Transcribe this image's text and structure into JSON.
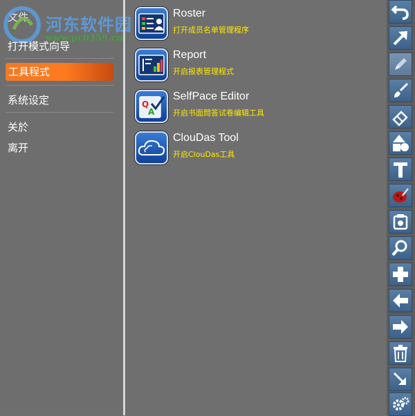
{
  "menu": {
    "title": "文件",
    "items": [
      {
        "label": "打开模式向导"
      },
      {
        "label": "工具程式"
      },
      {
        "label": "系统设定"
      },
      {
        "label": "关於"
      },
      {
        "label": "离开"
      }
    ]
  },
  "watermark": {
    "line1": "河东软件园",
    "line2": "www.pc0359.cn"
  },
  "tools": [
    {
      "name": "Roster",
      "desc": "打开成员名单管理程序",
      "icon": "roster-icon"
    },
    {
      "name": "Report",
      "desc": "开启报表管理程式",
      "icon": "report-chart-icon"
    },
    {
      "name": "SelfPace Editor",
      "desc": "开启书面問答试卷编辑工具",
      "icon": "qa-check-icon"
    },
    {
      "name": "ClouDas Tool",
      "desc": "开启ClouDas工具",
      "icon": "cloud-icon"
    }
  ],
  "toolbar": [
    "undo-icon",
    "pointer-arrow-icon",
    "pen-icon",
    "brush-icon",
    "eraser-icon",
    "shapes-icon",
    "text-icon",
    "color-palette-icon",
    "camera-icon",
    "zoom-icon",
    "add-icon",
    "back-arrow-icon",
    "forward-arrow-icon",
    "trash-icon",
    "minimize-icon",
    "settings-gear-icon"
  ],
  "colors": {
    "accent": "#f07a28",
    "panel": "#6e6e6e",
    "toolbar_button": "#4a6f96",
    "desc_text": "#ffe800"
  }
}
